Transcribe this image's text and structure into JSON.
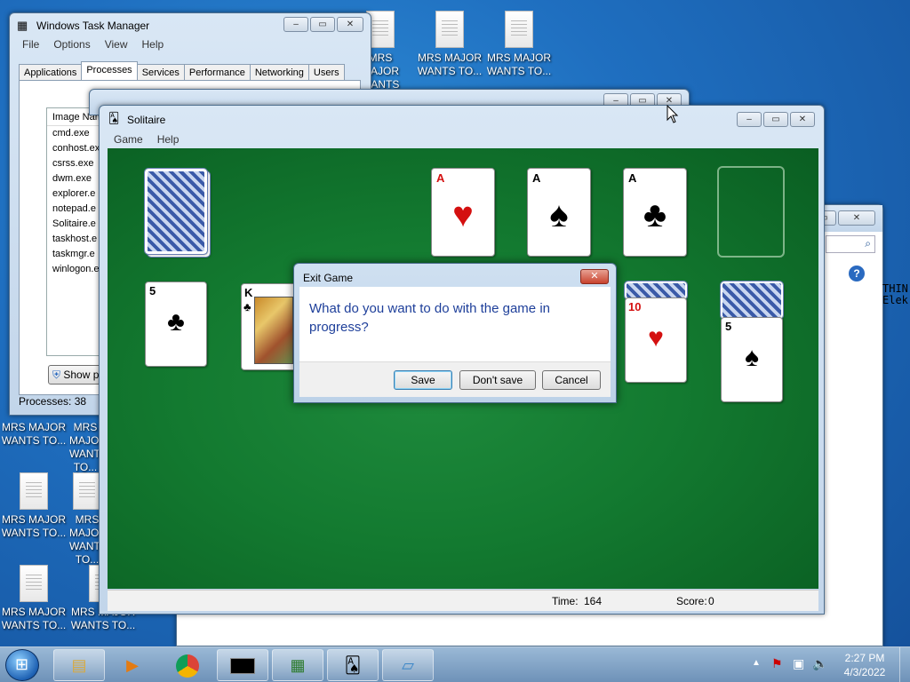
{
  "desktop": {
    "icons": [
      {
        "label_line1": "MRS MAJOR",
        "label_line2": "WANTS TO..."
      },
      {
        "label_line1": "MRS MAJOR",
        "label_line2": "WANTS TO..."
      },
      {
        "label_line1": "MRS MAJOR",
        "label_line2": "WANTS TO..."
      },
      {
        "label_line1": "MRS MAJOR",
        "label_line2": "WANTS TO..."
      },
      {
        "label_line1": "MRS MAJOR",
        "label_line2": "WANTS TO..."
      },
      {
        "label_line1": "MRS MAJOR",
        "label_line2": "WANTS TO..."
      },
      {
        "label_line1": "MRS MAJOR",
        "label_line2": "WANTS TO..."
      },
      {
        "label_line1": "MRS MAJOR",
        "label_line2": "WANTS TO..."
      },
      {
        "label_line1": "MRS MAJOR",
        "label_line2": "WANTS TO..."
      }
    ]
  },
  "task_manager": {
    "title": "Windows Task Manager",
    "menu": [
      "File",
      "Options",
      "View",
      "Help"
    ],
    "tabs": [
      "Applications",
      "Processes",
      "Services",
      "Performance",
      "Networking",
      "Users"
    ],
    "column_header": "Image Nam",
    "processes": [
      "cmd.exe",
      "conhost.ex",
      "csrss.exe",
      "dwm.exe",
      "explorer.e",
      "notepad.e",
      "Solitaire.e",
      "taskhost.e",
      "taskmgr.e",
      "winlogon.e"
    ],
    "show_button": "Show p",
    "status": "Processes: 38"
  },
  "solitaire": {
    "title": "Solitaire",
    "menu": [
      "Game",
      "Help"
    ],
    "time_label": "Time:",
    "time_value": "164",
    "score_label": "Score:",
    "score_value": "0",
    "foundations": [
      {
        "rank": "A",
        "suit": "♥",
        "color": "#d41010"
      },
      {
        "rank": "A",
        "suit": "♠",
        "color": "#000000"
      },
      {
        "rank": "A",
        "suit": "♣",
        "color": "#000000"
      }
    ],
    "tableau": [
      {
        "rank": "5",
        "suit": "♣",
        "color": "#000000"
      },
      {
        "rank": "K",
        "suit": "♣",
        "color": "#000000"
      },
      {
        "rank": "10",
        "suit": "♥",
        "color": "#d41010"
      },
      {
        "rank": "5",
        "suit": "♠",
        "color": "#000000"
      }
    ]
  },
  "dialog": {
    "title": "Exit Game",
    "message": "What do you want to do with the game in progress?",
    "save": "Save",
    "dont_save": "Don't save",
    "cancel": "Cancel"
  },
  "background_text": {
    "line1": "THIN",
    "line2": "Elek"
  },
  "taskbar": {
    "clock_time": "2:27 PM",
    "clock_date": "4/3/2022"
  }
}
